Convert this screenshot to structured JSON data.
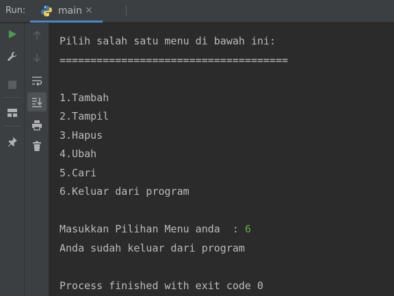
{
  "run": {
    "label": "Run:"
  },
  "tab": {
    "label": "main",
    "close": "×"
  },
  "toolbar": {
    "col1": [
      "rerun-icon",
      "wrench-icon",
      "stop-icon",
      "layout-icon",
      "pin-icon"
    ],
    "col2": [
      "up-arrow-icon",
      "down-arrow-icon",
      "soft-wrap-icon",
      "scroll-to-end-icon",
      "print-icon",
      "trash-icon"
    ]
  },
  "console": {
    "lines": [
      "Pilih salah satu menu di bawah ini:",
      "=====================================",
      "",
      "1.Tambah",
      "2.Tampil",
      "3.Hapus",
      "4.Ubah",
      "5.Cari",
      "6.Keluar dari program",
      "",
      "Masukkan Pilihan Menu anda  : ",
      "Anda sudah keluar dari program",
      "",
      "Process finished with exit code 0"
    ],
    "user_input": "6"
  },
  "colors": {
    "background": "#2b2b2b",
    "panel": "#3c3f41",
    "text": "#bbbbbb",
    "input": "#5faf45",
    "run_green": "#499c54",
    "tab_accent": "#4a88c7"
  }
}
